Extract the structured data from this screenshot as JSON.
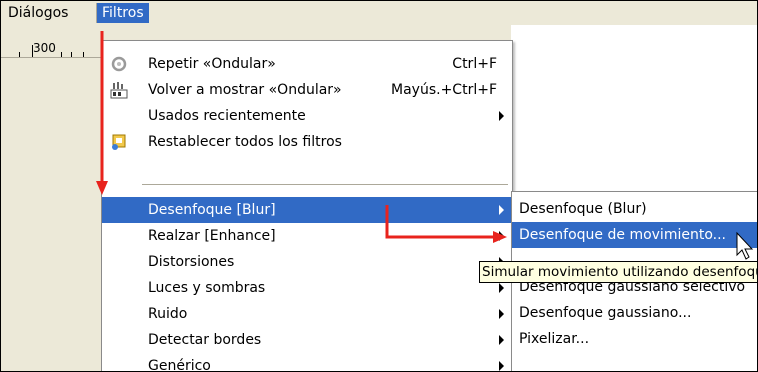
{
  "menubar": {
    "items": [
      {
        "label": "Diálogos"
      },
      {
        "label": "Filtros"
      }
    ]
  },
  "ruler": {
    "label": "300"
  },
  "filters_menu": {
    "items": [
      {
        "label": "Repetir «Ondular»",
        "accel": "Ctrl+F",
        "icon": "repeat-icon"
      },
      {
        "label": "Volver a mostrar «Ondular»",
        "accel": "Mayús.+Ctrl+F",
        "icon": "reshow-icon"
      },
      {
        "label": "Usados recientemente",
        "has_submenu": true
      },
      {
        "label": "Restablecer todos los filtros",
        "icon": "reset-icon"
      },
      {
        "label": "Desenfoque [Blur]",
        "has_submenu": true,
        "highlighted": true
      },
      {
        "label": "Realzar [Enhance]",
        "has_submenu": true
      },
      {
        "label": "Distorsiones",
        "has_submenu": true
      },
      {
        "label": "Luces y sombras",
        "has_submenu": true
      },
      {
        "label": "Ruido",
        "has_submenu": true
      },
      {
        "label": "Detectar bordes",
        "has_submenu": true
      },
      {
        "label": "Genérico",
        "has_submenu": true
      }
    ]
  },
  "blur_submenu": {
    "items": [
      {
        "label": "Desenfoque (Blur)"
      },
      {
        "label": "Desenfoque de movimiento...",
        "highlighted": true
      },
      {
        "label": "Desenfoque gaussiano selectivo"
      },
      {
        "label": "Desenfoque gaussiano..."
      },
      {
        "label": "Pixelizar..."
      }
    ]
  },
  "tooltip": {
    "text": "Simular movimiento utilizando desenfoque"
  },
  "colors": {
    "highlight": "#316ac5",
    "annotation_arrow": "#e8231d",
    "tooltip_bg": "#ffffe1"
  }
}
